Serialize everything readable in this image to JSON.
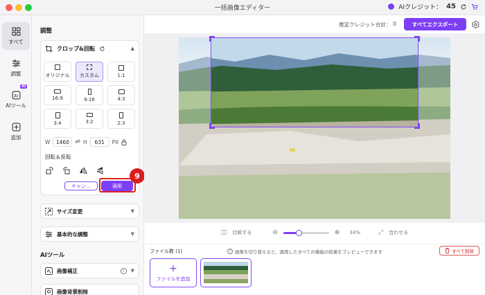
{
  "window": {
    "title": "一括画像エディター",
    "credits_label": "AIクレジット：",
    "credits_value": "45"
  },
  "sidebar": {
    "items": [
      {
        "label": "すべて",
        "icon": "grid-icon"
      },
      {
        "label": "調整",
        "icon": "sliders-icon"
      },
      {
        "label": "AIツール",
        "icon": "ai-icon",
        "badge": "AI"
      },
      {
        "label": "追加",
        "icon": "plus-icon"
      }
    ]
  },
  "panel": {
    "section_adjust": "調整",
    "crop": {
      "title": "クロップ&回転",
      "ratios": [
        {
          "label": "オリジナル"
        },
        {
          "label": "カスタム",
          "active": true
        },
        {
          "label": "1:1"
        },
        {
          "label": "16:9"
        },
        {
          "label": "9:16"
        },
        {
          "label": "4:3"
        },
        {
          "label": "3:4"
        },
        {
          "label": "3:2"
        },
        {
          "label": "2:3"
        }
      ],
      "w_label": "W",
      "w_value": "1460",
      "h_label": "H",
      "h_value": "631",
      "unit": "PX",
      "rotate_label": "回転＆反転",
      "cancel": "キャン…",
      "apply": "適用",
      "step": "9"
    },
    "resize": "サイズ変更",
    "basic": "基本的な調整",
    "section_ai": "AIツール",
    "enhance": "画像補正",
    "bg_remove": "画像背景削除"
  },
  "header": {
    "estimated_label": "推定クレジット合計：",
    "estimated_value": "0",
    "export": "すべてエクスポート"
  },
  "zoom": {
    "compare": "比較する",
    "percent": "34%",
    "fit": "合わせる",
    "level": 0.34
  },
  "files": {
    "count_label": "ファイル数 (1)",
    "hint": "画像を切り替えると、適用したすべての機能の結果をプレビューできます",
    "delete_all": "すべて削除",
    "add_file": "ファイルを追加"
  },
  "colors": {
    "accent": "#7d3ff5",
    "highlight": "#e02020"
  }
}
